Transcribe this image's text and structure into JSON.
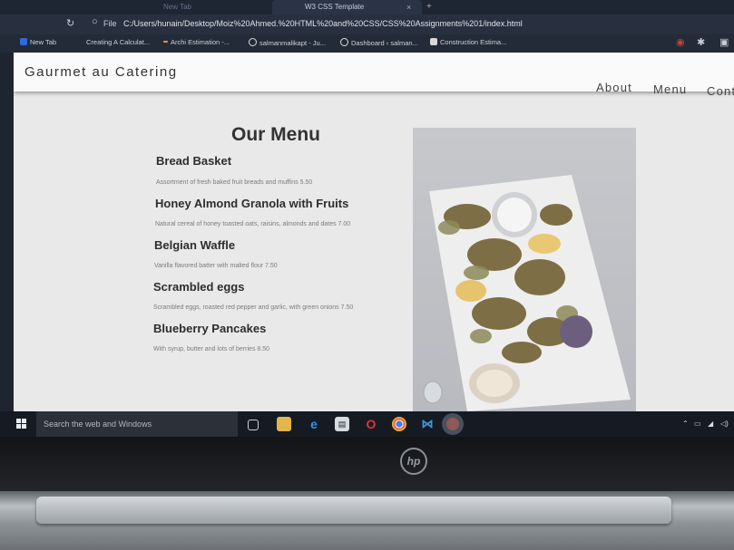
{
  "browser": {
    "tab_title": "W3 CSS Template",
    "ghost_tab": "New Tab",
    "file_label": "File",
    "url": "C:/Users/hunain/Desktop/Moiz%20Ahmed.%20HTML%20and%20CSS/CSS%20Assignments%201/index.html",
    "bookmarks": [
      {
        "label": "New Tab",
        "color": "#2d6cdf"
      },
      {
        "label": "Creating A Calculat...",
        "color": "#3a3f4a"
      },
      {
        "label": "Archi Estimation -...",
        "color": "#e0a030"
      },
      {
        "label": "salmanmalikapt - Ju...",
        "color": "#ffffff"
      },
      {
        "label": "Dashboard ‹ salman...",
        "color": "#ffffff"
      },
      {
        "label": "Construction Estima...",
        "color": "#d9d9d9"
      }
    ]
  },
  "site": {
    "brand": "Gaurmet au Catering",
    "nav": [
      "About",
      "Menu",
      "Cont"
    ]
  },
  "menu": {
    "title": "Our Menu",
    "items": [
      {
        "name": "Bread Basket",
        "desc": "Assortment of fresh baked fruit breads and muffins 5.50"
      },
      {
        "name": "Honey Almond Granola with Fruits",
        "desc": "Natural cereal of honey toasted oats, raisins, almonds and dates 7.00"
      },
      {
        "name": "Belgian Waffle",
        "desc": "Vanilla flavored batter with malted flour 7.50"
      },
      {
        "name": "Scrambled eggs",
        "desc": "Scrambled eggs, roasted red pepper and garlic, with green onions 7.50"
      },
      {
        "name": "Blueberry Pancakes",
        "desc": "With syrup, butter and lots of berries 8.50"
      }
    ]
  },
  "taskbar": {
    "search_placeholder": "Search the web and Windows",
    "icons": [
      "task-view-icon",
      "file-explorer-icon",
      "edge-icon",
      "store-icon",
      "opera-icon",
      "chrome-icon",
      "vscode-icon",
      "browser-icon"
    ]
  },
  "laptop": {
    "logo": "hp"
  }
}
